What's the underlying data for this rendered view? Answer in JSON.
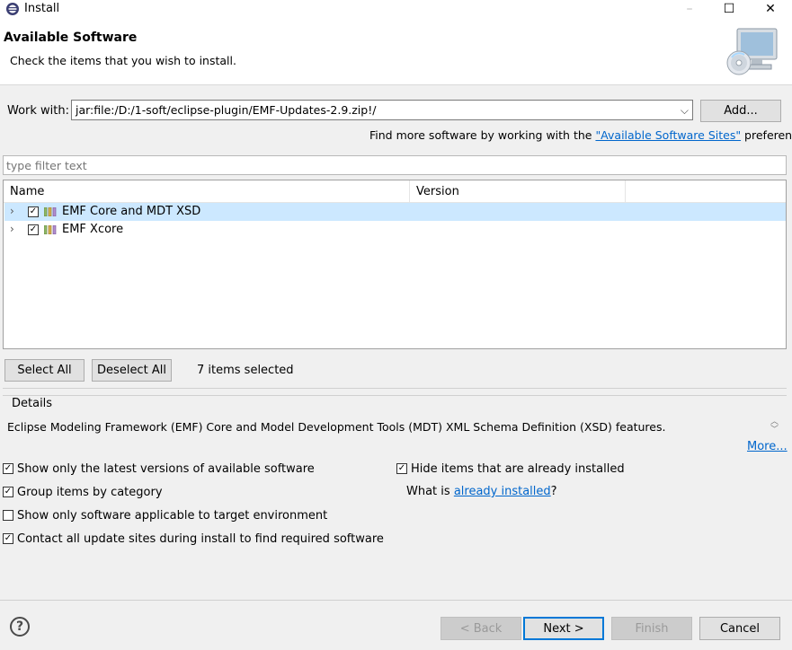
{
  "window": {
    "title": "Install",
    "controls": [
      "–",
      "☐",
      "✕"
    ]
  },
  "header": {
    "title": "Available Software",
    "subtitle": "Check the items that you wish to install."
  },
  "work_with": {
    "label": "Work with:",
    "value": "jar:file:/D:/1-soft/eclipse-plugin/EMF-Updates-2.9.zip!/",
    "add_label": "Add...",
    "find_more_prefix": "Find more software by working with the ",
    "find_more_link": "\"Available Software Sites\"",
    "find_more_suffix": " preferences."
  },
  "filter": {
    "placeholder": "type filter text"
  },
  "tree": {
    "columns": [
      "Name",
      "Version",
      ""
    ],
    "rows": [
      {
        "label": "EMF Core and MDT XSD",
        "checked": true,
        "selected": true
      },
      {
        "label": "EMF Xcore",
        "checked": true,
        "selected": false
      }
    ]
  },
  "selection": {
    "select_all": "Select All",
    "deselect_all": "Deselect All",
    "count_text": "7 items selected"
  },
  "details": {
    "label": "Details",
    "text": "Eclipse Modeling Framework (EMF) Core and Model Development Tools (MDT) XML Schema Definition (XSD) features.",
    "more_link": "More..."
  },
  "options": {
    "latest_versions": {
      "label": "Show only the latest versions of available software",
      "checked": true
    },
    "hide_installed": {
      "label": "Hide items that are already installed",
      "checked": true
    },
    "group_by_category": {
      "label": "Group items by category",
      "checked": true
    },
    "what_is_prefix": "What is ",
    "what_is_link": "already installed",
    "what_is_suffix": "?",
    "target_env": {
      "label": "Show only software applicable to target environment",
      "checked": false
    },
    "contact_sites": {
      "label": "Contact all update sites during install to find required software",
      "checked": true
    }
  },
  "footer": {
    "help": "?",
    "back": "< Back",
    "next": "Next >",
    "finish": "Finish",
    "cancel": "Cancel"
  }
}
